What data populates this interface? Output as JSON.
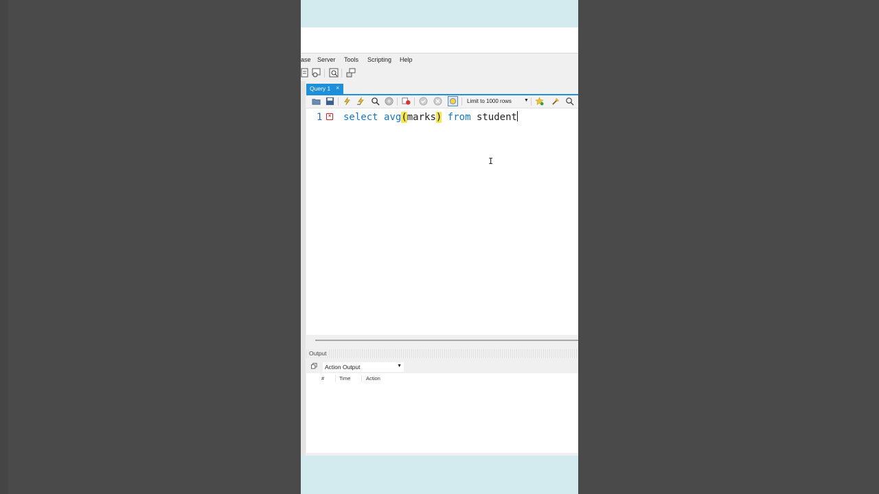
{
  "menu": {
    "items": [
      "ase",
      "Server",
      "Tools",
      "Scripting",
      "Help"
    ]
  },
  "main_toolbar": {
    "icons": [
      "sql-file-icon",
      "manage-connections-icon",
      "inspector-icon",
      "schema-migration-icon"
    ]
  },
  "query_tab": {
    "label": "Query 1",
    "close": "×"
  },
  "query_toolbar": {
    "icons": [
      "open-folder-icon",
      "save-icon",
      "execute-icon",
      "execute-current-icon",
      "explain-icon",
      "stop-icon",
      "toggle-error-icon",
      "commit-icon",
      "rollback-icon",
      "autocommit-icon"
    ],
    "limit_label": "Limit to 1000 rows",
    "right_icons": [
      "favorite-icon",
      "beautify-icon",
      "find-icon"
    ]
  },
  "editor": {
    "line_number": "1",
    "error_marker": "×",
    "code": {
      "kw1": "select",
      "fn": "avg",
      "open": "(",
      "arg": "marks",
      "close": ")",
      "kw2": "from",
      "table": "student"
    }
  },
  "output": {
    "title": "Output",
    "selector_value": "Action Output",
    "columns": [
      "#",
      "Time",
      "Action"
    ]
  },
  "colors": {
    "tab_blue": "#1e8fd8",
    "keyword_blue": "#1177c8",
    "bracket_highlight": "#f4e54a",
    "band": "#d3ebee"
  }
}
